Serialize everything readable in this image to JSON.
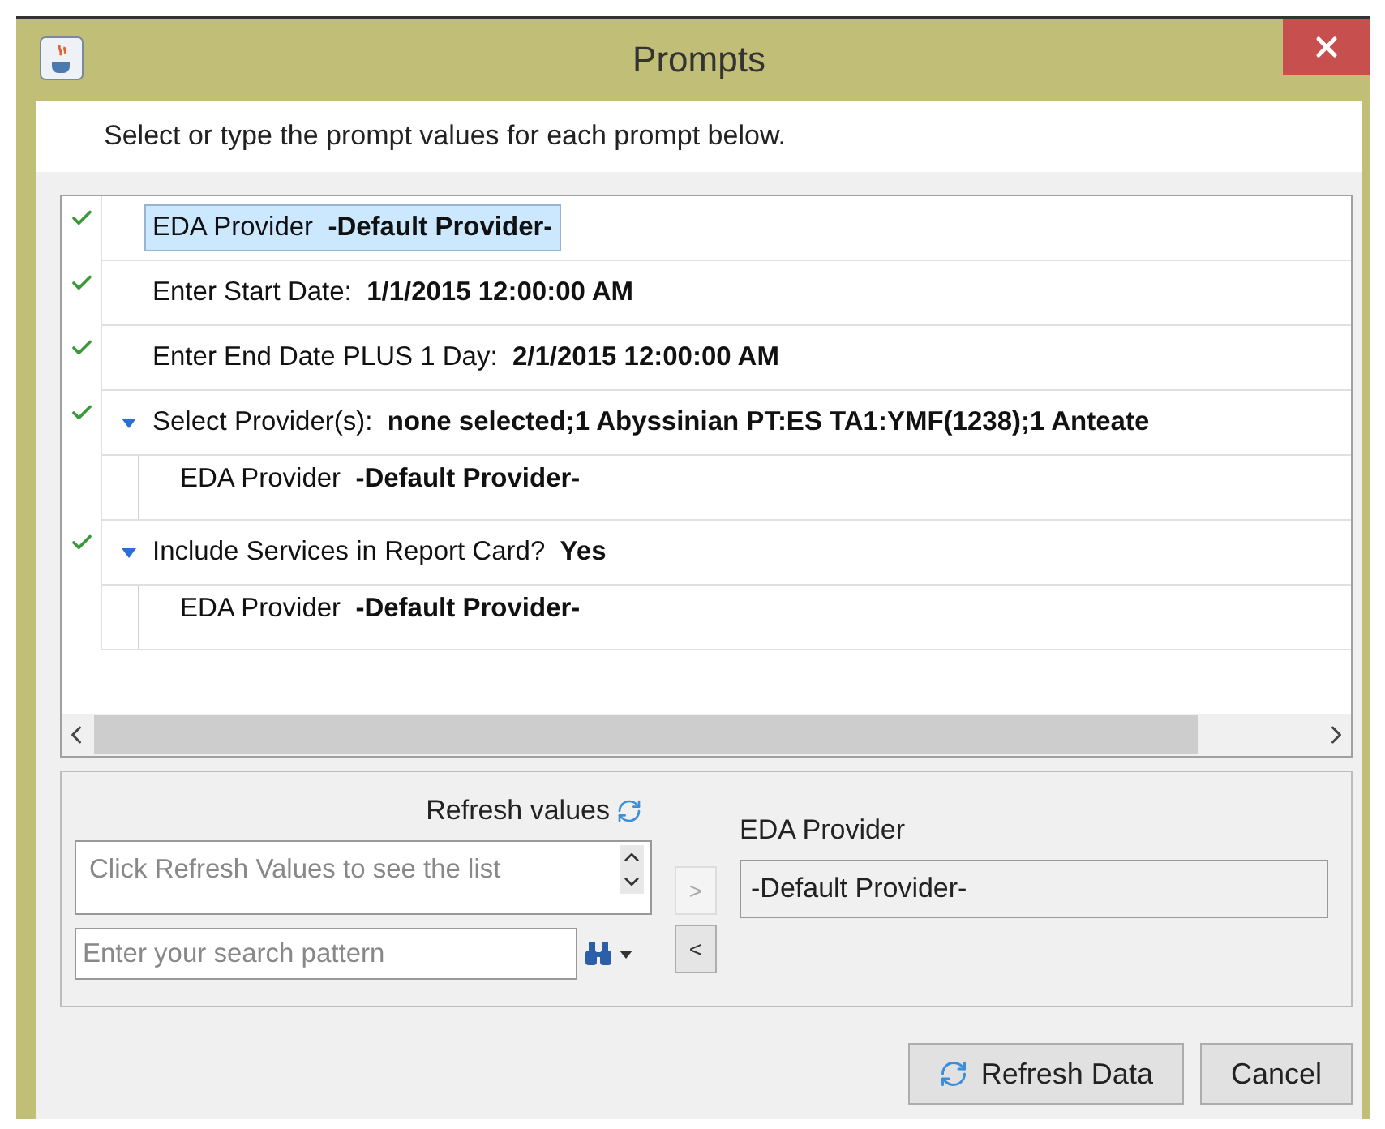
{
  "window": {
    "title": "Prompts"
  },
  "instruction": "Select or type the prompt values for each prompt below.",
  "prompts": [
    {
      "label": "EDA Provider",
      "value": "-Default Provider-",
      "checked": true,
      "selected": true
    },
    {
      "label": "Enter Start Date:",
      "value": "1/1/2015 12:00:00 AM",
      "checked": true,
      "selected": false
    },
    {
      "label": "Enter End Date PLUS 1 Day:",
      "value": "2/1/2015 12:00:00 AM",
      "checked": true,
      "selected": false
    },
    {
      "label": "Select Provider(s):",
      "value": "none selected;1 Abyssinian PT:ES TA1:YMF(1238);1 Anteate",
      "checked": true,
      "selected": false,
      "expanded": true,
      "children": [
        {
          "label": "EDA Provider",
          "value": "-Default Provider-"
        }
      ]
    },
    {
      "label": "Include Services in Report Card?",
      "value": "Yes",
      "checked": true,
      "selected": false,
      "expanded": true,
      "children": [
        {
          "label": "EDA Provider",
          "value": "-Default Provider-"
        }
      ]
    }
  ],
  "values_panel": {
    "refresh_label": "Refresh values",
    "list_placeholder": "Click Refresh Values to see the list",
    "search_placeholder": "Enter your search pattern",
    "add_button": {
      "label": ">",
      "disabled": true
    },
    "remove_button": {
      "label": "<",
      "disabled": false
    },
    "selected_title": "EDA Provider",
    "selected_value": "-Default Provider-"
  },
  "buttons": [
    {
      "label": "Refresh Data",
      "kind": "refresh"
    },
    {
      "label": "Cancel",
      "kind": "plain"
    }
  ]
}
